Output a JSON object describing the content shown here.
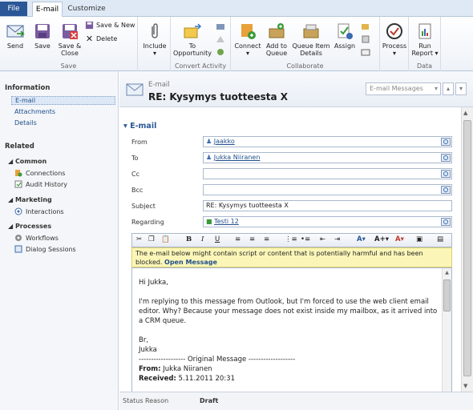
{
  "tabs": {
    "file": "File",
    "email": "E-mail",
    "customize": "Customize"
  },
  "ribbon": {
    "send": "Send",
    "save": "Save",
    "save_close_1": "Save &",
    "save_close_2": "Close",
    "save_new": "Save & New",
    "delete": "Delete",
    "group_save": "Save",
    "include": "Include",
    "to_opportunity_1": "To",
    "to_opportunity_2": "Opportunity",
    "group_convert": "Convert Activity",
    "connect": "Connect",
    "add_to_queue_1": "Add to",
    "add_to_queue_2": "Queue",
    "queue_item_details_1": "Queue Item",
    "queue_item_details_2": "Details",
    "assign": "Assign",
    "group_collaborate": "Collaborate",
    "process": "Process",
    "run_report_1": "Run",
    "run_report_2": "Report",
    "group_data": "Data"
  },
  "nav": {
    "information": "Information",
    "email": "E-mail",
    "attachments": "Attachments",
    "details": "Details",
    "related": "Related",
    "common": "Common",
    "connections": "Connections",
    "audit_history": "Audit History",
    "marketing": "Marketing",
    "interactions": "Interactions",
    "processes": "Processes",
    "workflows": "Workflows",
    "dialog_sessions": "Dialog Sessions"
  },
  "record": {
    "type": "E-mail",
    "title": "RE: Kysymys tuotteesta X",
    "view_selector": "E-mail Messages"
  },
  "form": {
    "section": "E-mail",
    "from_label": "From",
    "from_value": "Jaakko",
    "to_label": "To",
    "to_value": "Jukka Niiranen",
    "cc_label": "Cc",
    "bcc_label": "Bcc",
    "subject_label": "Subject",
    "subject_value": "RE: Kysymys tuotteesta X",
    "regarding_label": "Regarding",
    "regarding_value": "Testi 12"
  },
  "warning": {
    "text": "The e-mail below might contain script or content that is potentially harmful and has been blocked.",
    "link": "Open Message"
  },
  "body": {
    "greeting": "Hi Jukka,",
    "para": "I'm replying to this message from Outlook, but I'm forced to use the web client email editor. Why? Because your message does not exist inside my mailbox, as it arrived into a CRM queue.",
    "closing": "Br,",
    "signature": "Jukka",
    "original": "------------------- Original Message -------------------",
    "from_label": "From:",
    "from_value": "Jukka Niiranen",
    "received_label": "Received:",
    "received_value": "5.11.2011 20:31"
  },
  "status": {
    "label": "Status Reason",
    "value": "Draft"
  },
  "colors": {
    "accent": "#2b5797",
    "link": "#1f4e8c",
    "warning_bg": "#fbf6b8"
  }
}
